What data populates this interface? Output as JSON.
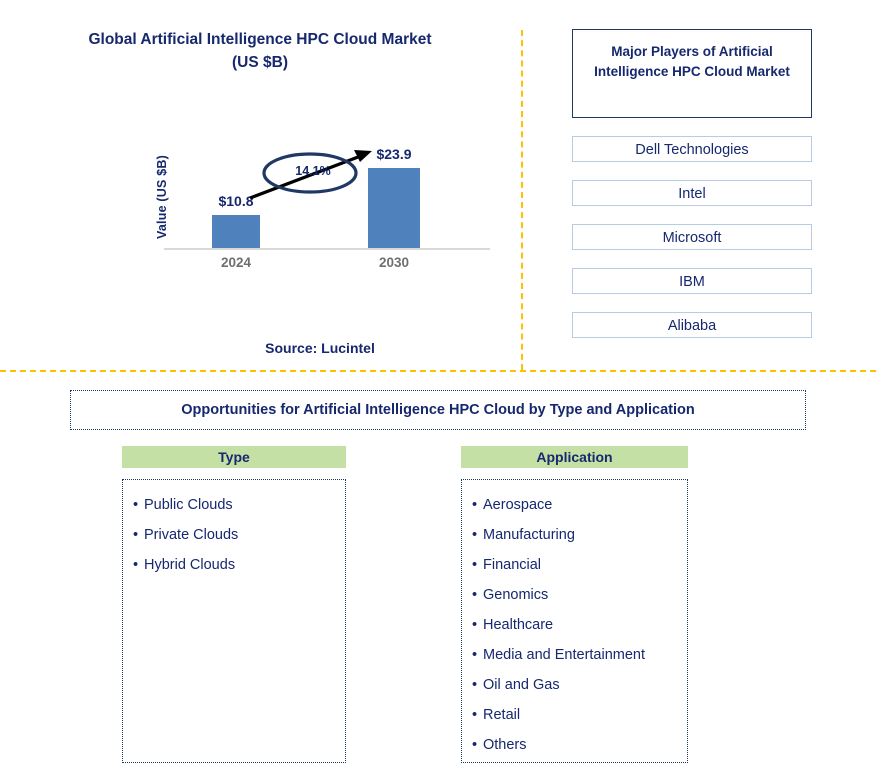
{
  "chart_panel": {
    "title_line1": "Global Artificial Intelligence HPC Cloud Market",
    "title_line2": "(US $B)",
    "source": "Source: Lucintel"
  },
  "chart_data": {
    "type": "bar",
    "title": "Global Artificial Intelligence HPC Cloud Market (US $B)",
    "categories": [
      "2024",
      "2030"
    ],
    "values": [
      10.8,
      23.9
    ],
    "value_labels": [
      "$10.8",
      "$23.9"
    ],
    "xlabel": "",
    "ylabel": "Value (US $B)",
    "ylim": [
      0,
      26
    ],
    "grid": false,
    "legend": false,
    "bar_color": "#4f81bd",
    "annotations": [
      {
        "text": "14.1%",
        "type": "cagr-callout",
        "from": "2024",
        "to": "2030"
      }
    ]
  },
  "players": {
    "header": "Major Players of Artificial Intelligence HPC Cloud Market",
    "items": [
      {
        "name": "Dell Technologies"
      },
      {
        "name": "Intel"
      },
      {
        "name": "Microsoft"
      },
      {
        "name": "IBM"
      },
      {
        "name": "Alibaba"
      }
    ]
  },
  "opportunities": {
    "banner": "Opportunities for Artificial Intelligence HPC Cloud by Type and Application",
    "columns": [
      {
        "header": "Type",
        "items": [
          "Public Clouds",
          "Private Clouds",
          "Hybrid Clouds"
        ]
      },
      {
        "header": "Application",
        "items": [
          "Aerospace",
          "Manufacturing",
          "Financial",
          "Genomics",
          "Healthcare",
          "Media and Entertainment",
          "Oil and Gas",
          "Retail",
          "Others"
        ]
      }
    ]
  },
  "bullet": "•",
  "colors": {
    "bar": "#4f81bd",
    "navy_text": "#16286e",
    "divider": "#ffc000",
    "header_green": "#c5e0a5",
    "player_border": "#b8cce4"
  }
}
